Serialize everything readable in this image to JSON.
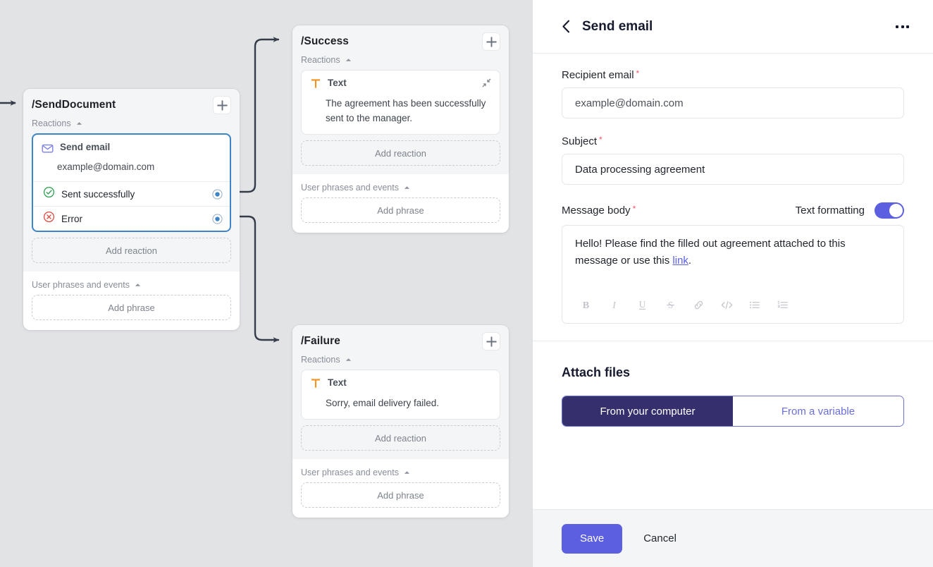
{
  "canvas": {
    "nodes": [
      {
        "title": "/SendDocument",
        "add_button": "+",
        "reactions_label": "Reactions",
        "reaction": {
          "icon": "envelope-icon",
          "name": "Send email",
          "value": "example@domain.com",
          "selected": true,
          "outcomes": [
            {
              "icon": "check-circle-icon",
              "label": "Sent successfully"
            },
            {
              "icon": "error-circle-icon",
              "label": "Error"
            }
          ]
        },
        "add_reaction_label": "Add reaction",
        "phrases_label": "User phrases and events",
        "add_phrase_label": "Add phrase"
      },
      {
        "title": "/Success",
        "add_button": "+",
        "reactions_label": "Reactions",
        "reaction": {
          "icon": "text-icon",
          "name": "Text",
          "body": "The agreement has been successfully sent to the manager."
        },
        "add_reaction_label": "Add reaction",
        "phrases_label": "User phrases and events",
        "add_phrase_label": "Add phrase"
      },
      {
        "title": "/Failure",
        "add_button": "+",
        "reactions_label": "Reactions",
        "reaction": {
          "icon": "text-icon",
          "name": "Text",
          "body": "Sorry, email delivery failed."
        },
        "add_reaction_label": "Add reaction",
        "phrases_label": "User phrases and events",
        "add_phrase_label": "Add phrase"
      }
    ]
  },
  "panel": {
    "header": {
      "back_icon": "chevron-left-icon",
      "title": "Send email",
      "menu_icon": "more-horizontal-icon"
    },
    "form": {
      "recipient": {
        "label": "Recipient email",
        "required_mark": "*",
        "value": "example@domain.com",
        "placeholder": "example@domain.com"
      },
      "subject": {
        "label": "Subject",
        "required_mark": "*",
        "value": "Data processing agreement",
        "placeholder": "Subject"
      },
      "message": {
        "label": "Message body",
        "required_mark": "*",
        "formatting_label": "Text formatting",
        "formatting_on": true,
        "body_before_link": "Hello! Please find the filled out agreement attached to this message or use this ",
        "body_link": "link",
        "body_after_link": ".",
        "toolbar": [
          {
            "name": "bold-icon",
            "glyph": "B"
          },
          {
            "name": "italic-icon",
            "glyph": "I"
          },
          {
            "name": "underline-icon",
            "glyph": "U"
          },
          {
            "name": "strikethrough-icon",
            "glyph": "S"
          },
          {
            "name": "link-icon",
            "glyph": "link"
          },
          {
            "name": "code-icon",
            "glyph": "</>"
          },
          {
            "name": "bulleted-list-icon",
            "glyph": "list"
          },
          {
            "name": "numbered-list-icon",
            "glyph": "olist"
          }
        ]
      }
    },
    "attach": {
      "title": "Attach files",
      "tabs": [
        {
          "label": "From your computer",
          "selected": true
        },
        {
          "label": "From a variable",
          "selected": false
        }
      ]
    },
    "footer": {
      "save_label": "Save",
      "cancel_label": "Cancel"
    }
  },
  "colors": {
    "accent": "#5b5fe0",
    "accent_dark": "#35306d",
    "required": "#f3576a",
    "success": "#2e9e4f",
    "error": "#e0483f",
    "selection_border": "#3d85c6",
    "text_icon": "#f5911e",
    "envelope_icon": "#7b7fe8",
    "canvas_bg": "#e2e3e5"
  }
}
